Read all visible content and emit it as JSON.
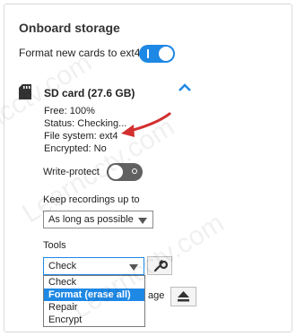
{
  "section": {
    "title": "Onboard storage",
    "format_label": "Format new cards to ext4",
    "format_toggle_on": true
  },
  "card": {
    "title": "SD card (27.6 GB)",
    "icon": "sd-card-icon",
    "expand_icon": "chevron-up-icon",
    "info": {
      "free": "Free: 100%",
      "status": "Status: Checking...",
      "filesystem": "File system: ext4",
      "encrypted": "Encrypted: No"
    },
    "write_protect_label": "Write-protect",
    "write_protect_on": false,
    "keep_label": "Keep recordings up to",
    "keep_value": "As long as possible",
    "tools_label": "Tools",
    "tools_value": "Check",
    "tools_options": [
      "Check",
      "Format (erase all)",
      "Repair",
      "Encrypt"
    ],
    "tools_highlighted": "Format (erase all)",
    "partially_hidden_text": "age",
    "wrench_icon": "wrench-icon",
    "eject_icon": "eject-icon"
  },
  "annotation": {
    "arrow_color": "#d32f2f"
  },
  "colors": {
    "accent": "#1e88e5",
    "toggle_off": "#616161"
  },
  "watermark": "Learncctv.com"
}
